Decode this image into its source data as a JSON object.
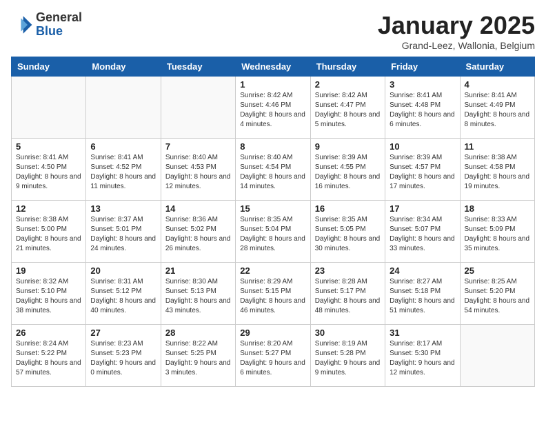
{
  "logo": {
    "general": "General",
    "blue": "Blue"
  },
  "header": {
    "month": "January 2025",
    "location": "Grand-Leez, Wallonia, Belgium"
  },
  "days_of_week": [
    "Sunday",
    "Monday",
    "Tuesday",
    "Wednesday",
    "Thursday",
    "Friday",
    "Saturday"
  ],
  "weeks": [
    [
      {
        "day": "",
        "info": ""
      },
      {
        "day": "",
        "info": ""
      },
      {
        "day": "",
        "info": ""
      },
      {
        "day": "1",
        "info": "Sunrise: 8:42 AM\nSunset: 4:46 PM\nDaylight: 8 hours\nand 4 minutes."
      },
      {
        "day": "2",
        "info": "Sunrise: 8:42 AM\nSunset: 4:47 PM\nDaylight: 8 hours\nand 5 minutes."
      },
      {
        "day": "3",
        "info": "Sunrise: 8:41 AM\nSunset: 4:48 PM\nDaylight: 8 hours\nand 6 minutes."
      },
      {
        "day": "4",
        "info": "Sunrise: 8:41 AM\nSunset: 4:49 PM\nDaylight: 8 hours\nand 8 minutes."
      }
    ],
    [
      {
        "day": "5",
        "info": "Sunrise: 8:41 AM\nSunset: 4:50 PM\nDaylight: 8 hours\nand 9 minutes."
      },
      {
        "day": "6",
        "info": "Sunrise: 8:41 AM\nSunset: 4:52 PM\nDaylight: 8 hours\nand 11 minutes."
      },
      {
        "day": "7",
        "info": "Sunrise: 8:40 AM\nSunset: 4:53 PM\nDaylight: 8 hours\nand 12 minutes."
      },
      {
        "day": "8",
        "info": "Sunrise: 8:40 AM\nSunset: 4:54 PM\nDaylight: 8 hours\nand 14 minutes."
      },
      {
        "day": "9",
        "info": "Sunrise: 8:39 AM\nSunset: 4:55 PM\nDaylight: 8 hours\nand 16 minutes."
      },
      {
        "day": "10",
        "info": "Sunrise: 8:39 AM\nSunset: 4:57 PM\nDaylight: 8 hours\nand 17 minutes."
      },
      {
        "day": "11",
        "info": "Sunrise: 8:38 AM\nSunset: 4:58 PM\nDaylight: 8 hours\nand 19 minutes."
      }
    ],
    [
      {
        "day": "12",
        "info": "Sunrise: 8:38 AM\nSunset: 5:00 PM\nDaylight: 8 hours\nand 21 minutes."
      },
      {
        "day": "13",
        "info": "Sunrise: 8:37 AM\nSunset: 5:01 PM\nDaylight: 8 hours\nand 24 minutes."
      },
      {
        "day": "14",
        "info": "Sunrise: 8:36 AM\nSunset: 5:02 PM\nDaylight: 8 hours\nand 26 minutes."
      },
      {
        "day": "15",
        "info": "Sunrise: 8:35 AM\nSunset: 5:04 PM\nDaylight: 8 hours\nand 28 minutes."
      },
      {
        "day": "16",
        "info": "Sunrise: 8:35 AM\nSunset: 5:05 PM\nDaylight: 8 hours\nand 30 minutes."
      },
      {
        "day": "17",
        "info": "Sunrise: 8:34 AM\nSunset: 5:07 PM\nDaylight: 8 hours\nand 33 minutes."
      },
      {
        "day": "18",
        "info": "Sunrise: 8:33 AM\nSunset: 5:09 PM\nDaylight: 8 hours\nand 35 minutes."
      }
    ],
    [
      {
        "day": "19",
        "info": "Sunrise: 8:32 AM\nSunset: 5:10 PM\nDaylight: 8 hours\nand 38 minutes."
      },
      {
        "day": "20",
        "info": "Sunrise: 8:31 AM\nSunset: 5:12 PM\nDaylight: 8 hours\nand 40 minutes."
      },
      {
        "day": "21",
        "info": "Sunrise: 8:30 AM\nSunset: 5:13 PM\nDaylight: 8 hours\nand 43 minutes."
      },
      {
        "day": "22",
        "info": "Sunrise: 8:29 AM\nSunset: 5:15 PM\nDaylight: 8 hours\nand 46 minutes."
      },
      {
        "day": "23",
        "info": "Sunrise: 8:28 AM\nSunset: 5:17 PM\nDaylight: 8 hours\nand 48 minutes."
      },
      {
        "day": "24",
        "info": "Sunrise: 8:27 AM\nSunset: 5:18 PM\nDaylight: 8 hours\nand 51 minutes."
      },
      {
        "day": "25",
        "info": "Sunrise: 8:25 AM\nSunset: 5:20 PM\nDaylight: 8 hours\nand 54 minutes."
      }
    ],
    [
      {
        "day": "26",
        "info": "Sunrise: 8:24 AM\nSunset: 5:22 PM\nDaylight: 8 hours\nand 57 minutes."
      },
      {
        "day": "27",
        "info": "Sunrise: 8:23 AM\nSunset: 5:23 PM\nDaylight: 9 hours\nand 0 minutes."
      },
      {
        "day": "28",
        "info": "Sunrise: 8:22 AM\nSunset: 5:25 PM\nDaylight: 9 hours\nand 3 minutes."
      },
      {
        "day": "29",
        "info": "Sunrise: 8:20 AM\nSunset: 5:27 PM\nDaylight: 9 hours\nand 6 minutes."
      },
      {
        "day": "30",
        "info": "Sunrise: 8:19 AM\nSunset: 5:28 PM\nDaylight: 9 hours\nand 9 minutes."
      },
      {
        "day": "31",
        "info": "Sunrise: 8:17 AM\nSunset: 5:30 PM\nDaylight: 9 hours\nand 12 minutes."
      },
      {
        "day": "",
        "info": ""
      }
    ]
  ]
}
